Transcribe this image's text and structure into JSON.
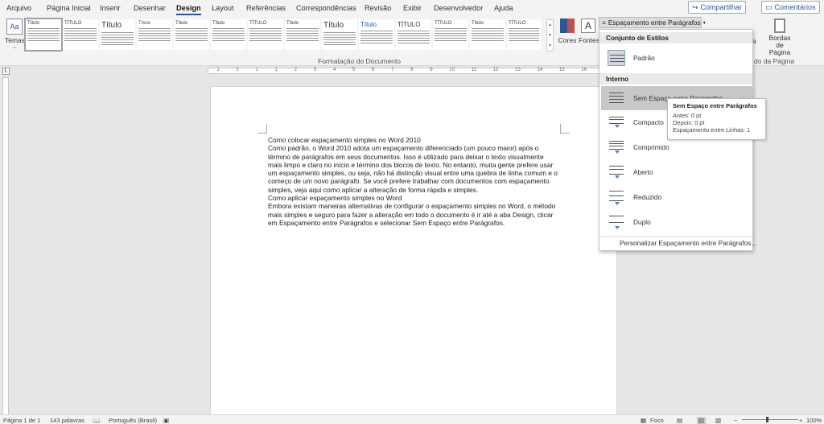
{
  "tabs": [
    "Arquivo",
    "Página Inicial",
    "Inserir",
    "Desenhar",
    "Design",
    "Layout",
    "Referências",
    "Correspondências",
    "Revisão",
    "Exibir",
    "Desenvolvedor",
    "Ajuda"
  ],
  "share_label": "Compartilhar",
  "comments_label": "Comentários",
  "ribbon": {
    "themes_label": "Temas",
    "gallery_titles": [
      "Título",
      "TÍTULO",
      "Título",
      "Título",
      "Título",
      "Título",
      "TÍTULO",
      "Título",
      "Título",
      "Título",
      "TÍTULO",
      "TÍTULO",
      "Título",
      "TÍTULO",
      "Título"
    ],
    "group_label": "Formatação do Documento",
    "colors_label": "Cores",
    "fonts_label": "Fontes",
    "spacing_button": "Espaçamento entre Parágrafos",
    "page_borders_label": "Bordas de Página",
    "page_bg_group": "do da Página",
    "partial_label": "da"
  },
  "dropdown": {
    "section1": "Conjunto de Estilos",
    "default_label": "Padrão",
    "section2": "Interno",
    "items": [
      "Sem Espaço entre Parágrafos",
      "Compacto",
      "Comprimido",
      "Aberto",
      "Reduzido",
      "Duplo"
    ],
    "custom_label": "Personalizar Espaçamento entre Parágrafos..."
  },
  "tooltip": {
    "title": "Sem Espaço entre Parágrafos",
    "before": "Antes: 0 pt",
    "after": "Depois: 0 pt",
    "line": "Espaçamento entre Linhas: 1"
  },
  "document": {
    "lines": [
      "Como colocar espaçamento simples no Word 2010",
      "Como padrão, o Word 2010 adota um espaçamento diferenciado (um pouco maior) após o término de parágrafos em seus documentos. Isso é utilizado para deixar o texto visualmente mais limpo e claro no início e término dos blocos de texto. No entanto, muita gente prefere usar um espaçamento simples, ou seja, não há distinção visual entre uma quebra de linha comum e o começo de um novo parágrafo. Se você prefere trabalhar com documentos com espaçamento simples, veja aqui como aplicar a alteração de forma rápida e simples.",
      "Como aplicar espaçamento simples no Word",
      "Embora existam maneiras alternativas de configurar o espaçamento simples no Word, o método mais simples e seguro para fazer a alteração em todo o documento é ir até a aba Design, clicar em Espaçamento entre Parágrafos e selecionar Sem Espaço entre Parágrafos."
    ]
  },
  "ruler_nums": [
    "1",
    "2",
    "1",
    "1",
    "2",
    "3",
    "4",
    "5",
    "6",
    "7",
    "8",
    "9",
    "10",
    "11",
    "12",
    "13",
    "14",
    "15",
    "16",
    "18"
  ],
  "status": {
    "page": "Página 1 de 1",
    "words": "143 palavras",
    "language": "Português (Brasil)",
    "focus": "Foco",
    "zoom": "100%"
  }
}
